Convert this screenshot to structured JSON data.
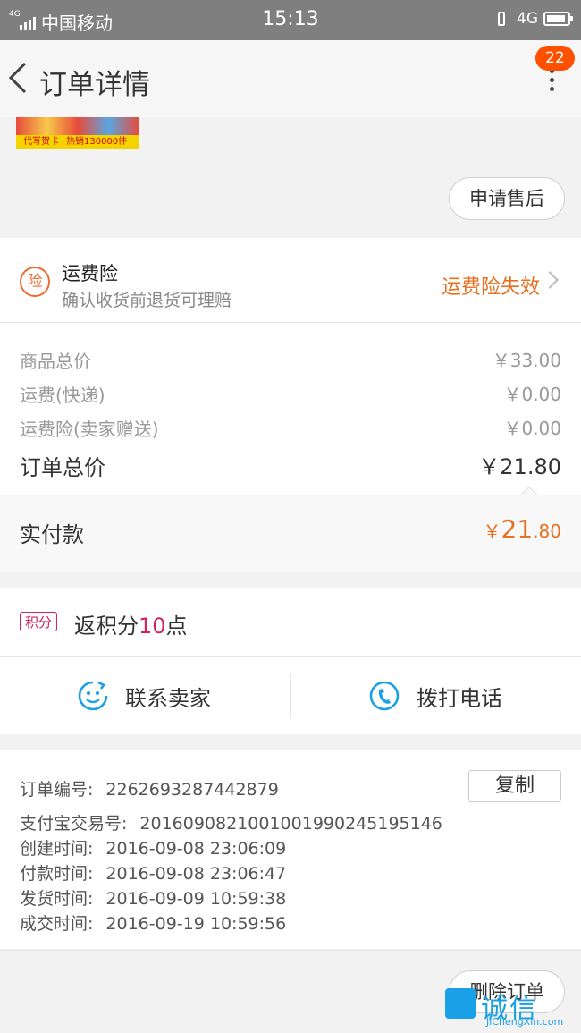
{
  "status_bar": {
    "network_tag": "4G",
    "carrier": "中国移动",
    "time": "15:13",
    "network": "4G"
  },
  "nav": {
    "title": "订单详情",
    "badge": "22"
  },
  "product": {
    "banner_left": "代写贺卡",
    "banner_right": "热销130000件"
  },
  "after_sale_button": "申请售后",
  "insurance": {
    "icon_char": "险",
    "title": "运费险",
    "subtitle": "确认收货前退货可理赔",
    "status": "运费险失效"
  },
  "prices": [
    {
      "label": "商品总价",
      "value": "￥33.00"
    },
    {
      "label": "运费(快递)",
      "value": "￥0.00"
    },
    {
      "label": "运费险(卖家赠送)",
      "value": "￥0.00"
    }
  ],
  "order_total": {
    "label": "订单总价",
    "value": "￥21.80"
  },
  "paid": {
    "label": "实付款",
    "currency": "￥",
    "integer": "21",
    "decimal": ".80"
  },
  "points": {
    "badge": "积分",
    "prefix": "返积分",
    "number": "10",
    "suffix": "点"
  },
  "contact": {
    "seller_label": "联系卖家",
    "phone_label": "拨打电话"
  },
  "order_info": [
    {
      "label": "订单编号:",
      "value": "2262693287442879"
    },
    {
      "label": "支付宝交易号:",
      "value": "2016090821001001990245195146"
    },
    {
      "label": "创建时间:",
      "value": "2016-09-08 23:06:09"
    },
    {
      "label": "付款时间:",
      "value": "2016-09-08 23:06:47"
    },
    {
      "label": "发货时间:",
      "value": "2016-09-09 10:59:38"
    },
    {
      "label": "成交时间:",
      "value": "2016-09-19 10:59:56"
    }
  ],
  "copy_button": "复制",
  "delete_button": "删除订单",
  "watermark": {
    "cn": "诚信",
    "en": "JiChengXin.com"
  },
  "colors": {
    "accent": "#ff5000",
    "orange": "#e86f1e",
    "points": "#d0245e",
    "icon_blue": "#1aa0e6"
  }
}
